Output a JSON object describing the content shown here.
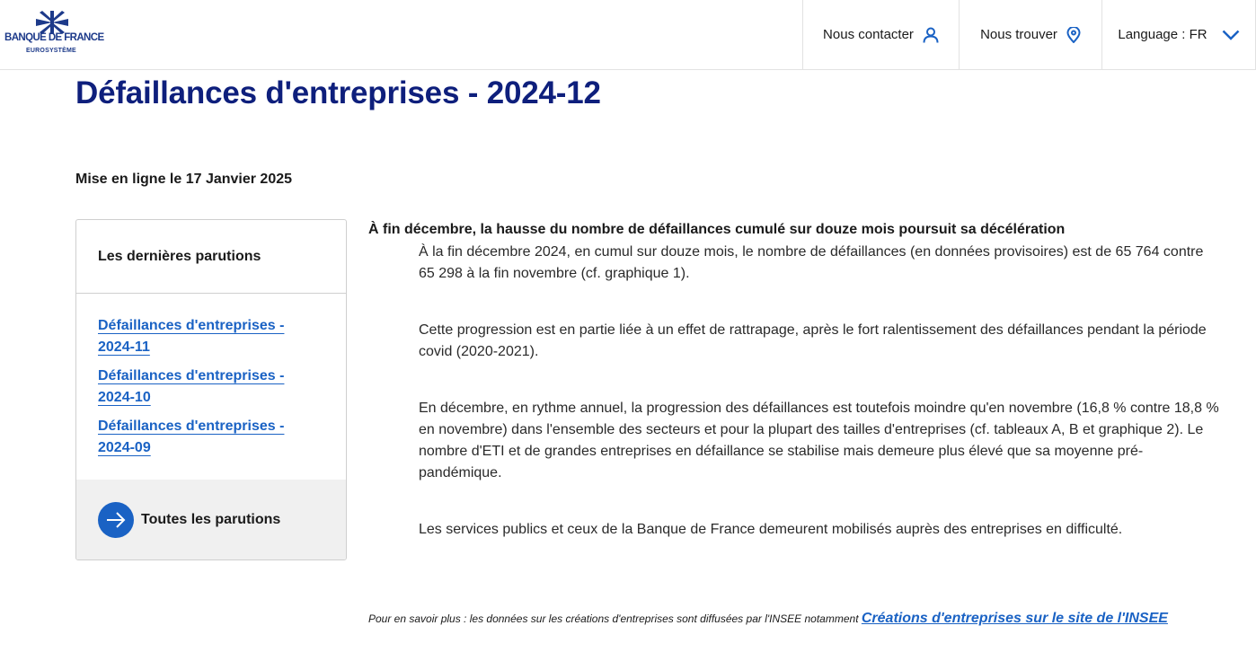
{
  "header": {
    "logo": {
      "name": "BANQUE DE FRANCE",
      "subtitle": "EUROSYSTÈME",
      "icon": "banque-de-france-emblem-icon"
    },
    "nav": {
      "contact_label": "Nous contacter",
      "contact_icon": "user-icon",
      "trouver_label": "Nous trouver",
      "trouver_icon": "map-pin-icon",
      "language_label": "Language : FR",
      "language_icon": "chevron-down-icon"
    }
  },
  "page": {
    "title": "Défaillances d'entreprises - 2024-12",
    "publish_date": "Mise en ligne le 17 Janvier 2025"
  },
  "sidebar": {
    "heading": "Les dernières parutions",
    "items": [
      {
        "label": "Défaillances d'entreprises - 2024-11"
      },
      {
        "label": "Défaillances d'entreprises - 2024-10"
      },
      {
        "label": "Défaillances d'entreprises - 2024-09"
      }
    ],
    "all_label": "Toutes les parutions",
    "all_icon": "arrow-right-icon"
  },
  "article": {
    "lead": "À fin décembre, la hausse du nombre de défaillances cumulé sur douze mois poursuit sa décélération",
    "paragraphs": [
      "À la fin décembre 2024, en cumul sur douze mois, le nombre de défaillances (en données provisoires) est de 65 764 contre 65 298 à la fin novembre (cf. graphique 1).",
      "Cette progression est en partie liée à un effet de rattrapage, après le fort ralentissement des défaillances pendant la période covid (2020-2021).",
      "En décembre, en rythme annuel, la progression des défaillances est toutefois moindre qu'en novembre (16,8 % contre 18,8 % en novembre) dans l'ensemble des secteurs et pour la plupart des tailles d'entreprises (cf. tableaux A, B et graphique 2). Le nombre d'ETI et de grandes entreprises en défaillance se stabilise mais demeure plus élevé que sa moyenne pré-pandémique.",
      "Les services publics et ceux de la Banque de France demeurent mobilisés auprès des entreprises en difficulté."
    ],
    "more_text": "Pour en savoir plus : les données sur les créations d'entreprises sont diffusées par l'INSEE notamment ",
    "more_link": "Créations d'entreprises sur le site de l'INSEE"
  },
  "colors": {
    "title_blue": "#0e1f7c",
    "link_blue": "#1a62c4",
    "logo_blue": "#1d3a8a"
  }
}
